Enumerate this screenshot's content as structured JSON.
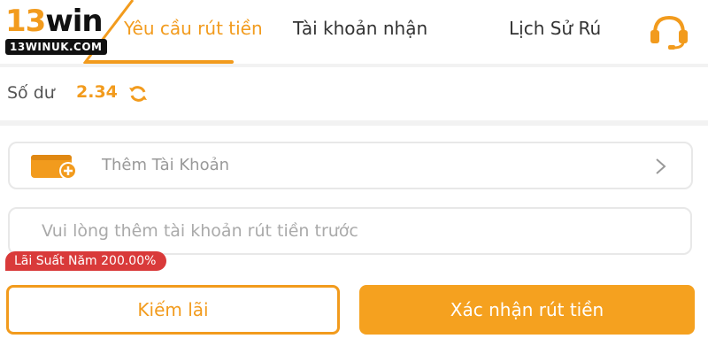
{
  "logo": {
    "main_prefix": "13",
    "main_suffix": "win",
    "sub": "13WINUK.COM"
  },
  "tabs": [
    {
      "label": "Yêu cầu rút tiền",
      "active": true
    },
    {
      "label": "Tài khoản nhận",
      "active": false
    },
    {
      "label": "Lịch Sử Rú",
      "active": false
    }
  ],
  "balance": {
    "label": "Số dư",
    "value": "2.34"
  },
  "add_account": {
    "label": "Thêm Tài Khoản"
  },
  "account_input": {
    "placeholder": "Vui lòng thêm tài khoản rút tiền trước",
    "value": ""
  },
  "rate_badge": "Lãi Suất Năm 200.00%",
  "buttons": {
    "earn": "Kiếm lãi",
    "confirm": "Xác nhận rút tiền"
  },
  "icons": {
    "support": "headset-icon",
    "refresh": "refresh-icon",
    "wallet": "wallet-add-icon",
    "chevron": "chevron-right-icon"
  },
  "colors": {
    "accent": "#f29b1d",
    "badge": "#d93a3a"
  }
}
